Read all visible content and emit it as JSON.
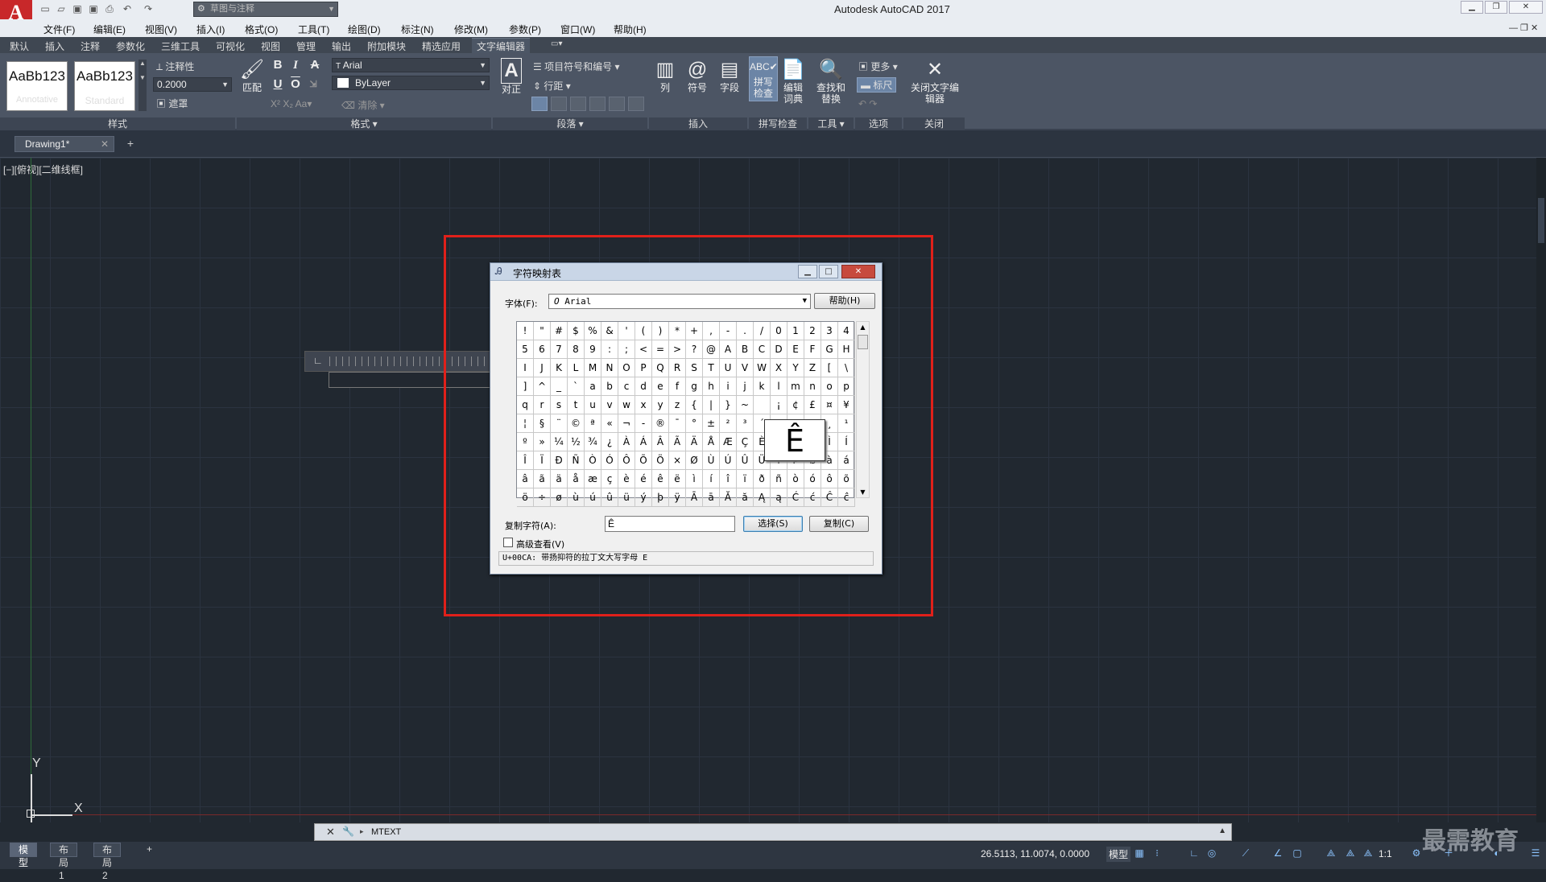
{
  "app": {
    "logo": "A",
    "title": "Autodesk AutoCAD 2017",
    "workspace": "草图与注释"
  },
  "menu": [
    "文件(F)",
    "编辑(E)",
    "视图(V)",
    "插入(I)",
    "格式(O)",
    "工具(T)",
    "绘图(D)",
    "标注(N)",
    "修改(M)",
    "参数(P)",
    "窗口(W)",
    "帮助(H)"
  ],
  "ribbon_tabs": [
    "默认",
    "插入",
    "注释",
    "参数化",
    "三维工具",
    "可视化",
    "视图",
    "管理",
    "输出",
    "附加模块",
    "精选应用",
    "文字编辑器"
  ],
  "ribbon": {
    "style": {
      "swatch1_text": "AaBb123",
      "swatch1_caption": "Annotative",
      "swatch2_text": "AaBb123",
      "swatch2_caption": "Standard",
      "annotative_label": "注释性",
      "height_value": "0.2000",
      "mask_label": "遮罩",
      "panel_label": "样式"
    },
    "format": {
      "match_label": "匹配",
      "bold": "B",
      "italic": "I",
      "underline": "U",
      "overline": "O",
      "strike": "A",
      "font_value": "Arial",
      "color_value": "ByLayer",
      "clear_label": "清除",
      "panel_label": "格式"
    },
    "paragraph": {
      "justify_label": "对正",
      "bullets_label": "项目符号和编号",
      "spacing_label": "行距",
      "panel_label": "段落"
    },
    "insert": {
      "columns_label": "列",
      "symbol_label": "符号",
      "field_label": "字段",
      "panel_label": "插入"
    },
    "spell": {
      "check_label": "拼写检查",
      "dict_label": "编辑词典",
      "panel_label": "拼写检查"
    },
    "tools": {
      "find_label": "查找和替换",
      "panel_label": "工具"
    },
    "options": {
      "more_label": "更多",
      "ruler_label": "标尺",
      "panel_label": "选项"
    },
    "close": {
      "close_label": "关闭文字编辑器",
      "panel_label": "关闭"
    }
  },
  "doc_tab": {
    "name": "Drawing1*"
  },
  "viewport_label": "[−][俯视][二维线框]",
  "charmap": {
    "title": "字符映射表",
    "font_label": "字体(F):",
    "font_value": "Arial",
    "help_button": "帮助(H)",
    "rows": [
      [
        "!",
        "\"",
        "#",
        "$",
        "%",
        "&",
        "'",
        "(",
        ")",
        "*",
        "+",
        ",",
        "-",
        ".",
        "/",
        "0",
        "1",
        "2",
        "3",
        "4"
      ],
      [
        "5",
        "6",
        "7",
        "8",
        "9",
        ":",
        ";",
        "<",
        "=",
        ">",
        "?",
        "@",
        "A",
        "B",
        "C",
        "D",
        "E",
        "F",
        "G",
        "H"
      ],
      [
        "I",
        "J",
        "K",
        "L",
        "M",
        "N",
        "O",
        "P",
        "Q",
        "R",
        "S",
        "T",
        "U",
        "V",
        "W",
        "X",
        "Y",
        "Z",
        "[",
        "\\"
      ],
      [
        "]",
        "^",
        "_",
        "`",
        "a",
        "b",
        "c",
        "d",
        "e",
        "f",
        "g",
        "h",
        "i",
        "j",
        "k",
        "l",
        "m",
        "n",
        "o",
        "p"
      ],
      [
        "q",
        "r",
        "s",
        "t",
        "u",
        "v",
        "w",
        "x",
        "y",
        "z",
        "{",
        "|",
        "}",
        "~",
        " ",
        "¡",
        "¢",
        "£",
        "¤",
        "¥"
      ],
      [
        "¦",
        "§",
        "¨",
        "©",
        "ª",
        "«",
        "¬",
        "-",
        "®",
        "¯",
        "°",
        "±",
        "²",
        "³",
        "´",
        "µ",
        "¶",
        "·",
        "¸",
        "¹"
      ],
      [
        "º",
        "»",
        "¼",
        "½",
        "¾",
        "¿",
        "À",
        "Á",
        "Â",
        "Ã",
        "Ä",
        "Å",
        "Æ",
        "Ç",
        "È",
        "É",
        "Ê",
        "Ë",
        "Ì",
        "Í"
      ],
      [
        "Î",
        "Ï",
        "Ð",
        "Ñ",
        "Ò",
        "Ó",
        "Ô",
        "Õ",
        "Ö",
        "×",
        "Ø",
        "Ù",
        "Ú",
        "Û",
        "Ü",
        "Ý",
        "Þ",
        "ß",
        "à",
        "á"
      ],
      [
        "â",
        "ã",
        "ä",
        "å",
        "æ",
        "ç",
        "è",
        "é",
        "ê",
        "ë",
        "ì",
        "í",
        "î",
        "ï",
        "ð",
        "ñ",
        "ò",
        "ó",
        "ô",
        "õ"
      ],
      [
        "ö",
        "÷",
        "ø",
        "ù",
        "ú",
        "û",
        "ü",
        "ý",
        "þ",
        "ÿ",
        "Ā",
        "ā",
        "Ă",
        "ă",
        "Ą",
        "ą",
        "Ć",
        "ć",
        "Ĉ",
        "ĉ"
      ]
    ],
    "zoom_char": "Ê",
    "copy_label": "复制字符(A):",
    "copy_value": "Ê",
    "select_button": "选择(S)",
    "copy_button": "复制(C)",
    "advanced_label": "高级查看(V)",
    "status": "U+00CA: 带扬抑符的拉丁文大写字母 E"
  },
  "ucs": {
    "x": "X",
    "y": "Y"
  },
  "command": {
    "prompt": "MTEXT"
  },
  "layout_tabs": [
    "模型",
    "布局1",
    "布局2"
  ],
  "status": {
    "coords": "26.5113, 11.0074, 0.0000",
    "model": "模型",
    "scale": "1:1"
  },
  "watermark": "最需教育",
  "colors": {
    "accent_frame": "#e0201a",
    "canvas": "#212830",
    "ribbon": "#4c5564"
  }
}
